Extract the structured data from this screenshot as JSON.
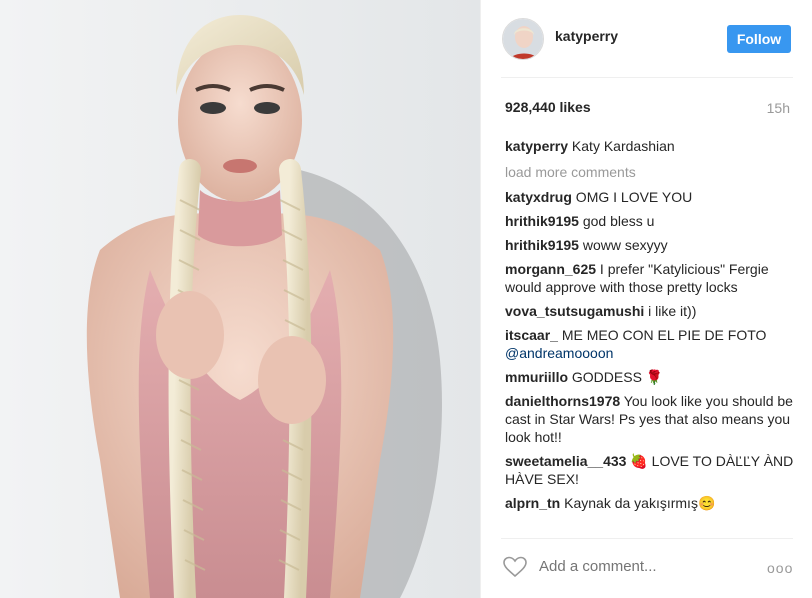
{
  "post": {
    "username": "katyperry",
    "follow_label": "Follow",
    "likes": "928,440 likes",
    "time": "15h",
    "caption": {
      "user": "katyperry",
      "text": " Katy Kardashian"
    },
    "load_more": "load more comments",
    "comments": [
      {
        "user": "katyxdrug",
        "text": " OMG I LOVE YOU"
      },
      {
        "user": "hrithik9195",
        "text": " god bless u"
      },
      {
        "user": "hrithik9195",
        "text": " woww sexyyy"
      },
      {
        "user": "morgann_625",
        "text": " I prefer \"Katylicious\" Fergie would approve with those pretty locks"
      },
      {
        "user": "vova_tsutsugamushi",
        "text": " i like it))"
      },
      {
        "user": "itscaar_",
        "text": " ME MEO CON EL PIE DE FOTO ",
        "mention": "@andreamoooon"
      },
      {
        "user": "mmuriillo",
        "text": " GODDESS ",
        "emoji": "🌹"
      },
      {
        "user": "danielthorns1978",
        "text": " You look like you should be cast in Star Wars! Ps yes that also means you look hot!!"
      },
      {
        "user": "sweetamelia__433",
        "text": " ",
        "emoji": "🍓",
        "text2": " LOVE TO DÀĽĽY ÀND HÀVE SEX!"
      },
      {
        "user": "alprn_tn",
        "text": " Kaynak da yakışırmış",
        "emoji": "😊"
      }
    ],
    "add_comment_placeholder": "Add a comment...",
    "more_options": "ooo"
  },
  "icons": {
    "heart": "heart-icon",
    "more": "more-options-icon"
  },
  "colors": {
    "accent": "#3897f0",
    "mention": "#003569",
    "muted": "#999999"
  }
}
